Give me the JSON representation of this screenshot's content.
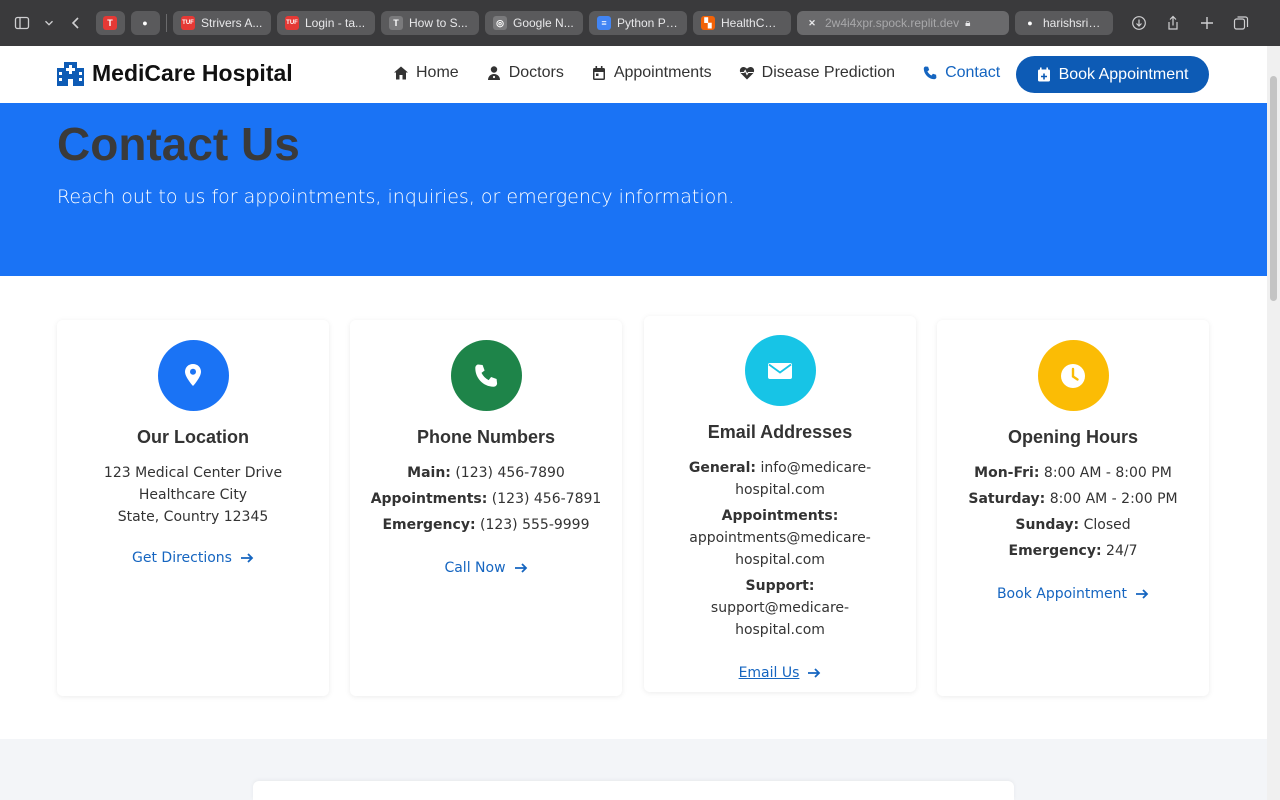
{
  "browser": {
    "tabs": [
      {
        "label": "Strivers A...",
        "fav_color": "#e53935",
        "fav_text": "TUF"
      },
      {
        "label": "Login - ta...",
        "fav_color": "#e53935",
        "fav_text": "TUF"
      },
      {
        "label": "How to S...",
        "fav_color": "#7a7a7c",
        "fav_text": "T"
      },
      {
        "label": "Google N...",
        "fav_color": "#7a7a7c",
        "fav_text": "◎"
      },
      {
        "label": "Python Pr...",
        "fav_color": "#4285f4",
        "fav_text": "≡"
      },
      {
        "label": "HealthCar...",
        "fav_color": "#f26207",
        "fav_text": "▚"
      },
      {
        "label": "2w4i4xpr.spock.replit.dev",
        "fav_color": "#5a5a5c",
        "fav_text": "✕"
      },
      {
        "label": "harishsrid...",
        "fav_color": "#5a5a5c",
        "fav_text": "●"
      }
    ]
  },
  "nav": {
    "brand": "MediCare Hospital",
    "links": [
      {
        "label": "Home",
        "icon": "home-icon"
      },
      {
        "label": "Doctors",
        "icon": "user-doctor-icon"
      },
      {
        "label": "Appointments",
        "icon": "calendar-icon"
      },
      {
        "label": "Disease Prediction",
        "icon": "heart-pulse-icon"
      },
      {
        "label": "Contact",
        "icon": "phone-icon"
      }
    ],
    "cta": "Book Appointment"
  },
  "hero": {
    "title": "Contact Us",
    "subtitle": "Reach out to us for appointments, inquiries, or emergency information."
  },
  "cards": {
    "location": {
      "title": "Our Location",
      "lines": [
        "123 Medical Center Drive",
        "Healthcare City",
        "State, Country 12345"
      ],
      "link": "Get Directions",
      "color": "#1a73f5"
    },
    "phone": {
      "title": "Phone Numbers",
      "rows": [
        {
          "label": "Main:",
          "value": "(123) 456-7890"
        },
        {
          "label": "Appointments:",
          "value": "(123) 456-7891"
        },
        {
          "label": "Emergency:",
          "value": "(123) 555-9999"
        }
      ],
      "link": "Call Now",
      "color": "#1e8449"
    },
    "email": {
      "title": "Email Addresses",
      "rows": [
        {
          "label": "General:",
          "value": "info@medicare-hospital.com"
        },
        {
          "label": "Appointments:",
          "value": "appointments@medicare-hospital.com"
        },
        {
          "label": "Support:",
          "value": "support@medicare-hospital.com"
        }
      ],
      "link": "Email Us",
      "color": "#17c4e6"
    },
    "hours": {
      "title": "Opening Hours",
      "rows": [
        {
          "label": "Mon-Fri:",
          "value": "8:00 AM - 8:00 PM"
        },
        {
          "label": "Saturday:",
          "value": "8:00 AM - 2:00 PM"
        },
        {
          "label": "Sunday:",
          "value": "Closed"
        },
        {
          "label": "Emergency:",
          "value": "24/7"
        }
      ],
      "link": "Book Appointment",
      "color": "#fbbc05"
    }
  }
}
